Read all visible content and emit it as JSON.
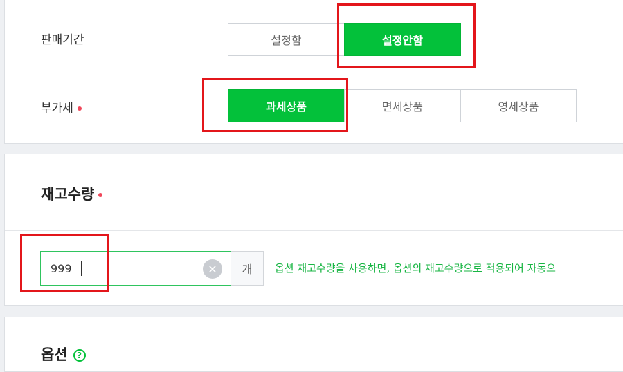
{
  "sale_period": {
    "label": "판매기간",
    "options": [
      "설정함",
      "설정안함"
    ],
    "selected": "설정안함"
  },
  "vat": {
    "label": "부가세",
    "options": [
      "과세상품",
      "면세상품",
      "영세상품"
    ],
    "selected": "과세상품"
  },
  "stock": {
    "title": "재고수량",
    "value": "999",
    "unit": "개",
    "help_text": "옵션 재고수량을 사용하면, 옵션의 재고수량으로 적용되어 자동으"
  },
  "option": {
    "title": "옵션"
  },
  "icons": {
    "clear": "clear-x-icon",
    "help": "question-circle-icon",
    "required": "required-dot-icon"
  },
  "colors": {
    "accent_green": "#03c13a",
    "required_red": "#f0475a",
    "highlight_red": "#e3161b",
    "help_green": "#18b543"
  }
}
